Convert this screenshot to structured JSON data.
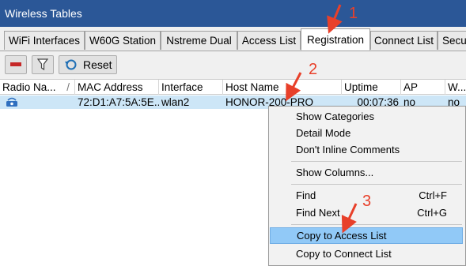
{
  "window": {
    "title": "Wireless Tables"
  },
  "tabs": [
    "WiFi Interfaces",
    "W60G Station",
    "Nstreme Dual",
    "Access List",
    "Registration",
    "Connect List",
    "Secu"
  ],
  "active_tab": "Registration",
  "toolbar": {
    "reset_label": "Reset"
  },
  "columns": [
    "Radio Na...",
    "MAC Address",
    "Interface",
    "Host Name",
    "Uptime",
    "AP",
    "W..."
  ],
  "rows": [
    {
      "radio": "",
      "mac": "72:D1:A7:5A:5E...",
      "interface": "wlan2",
      "host": "HONOR-200-PRO",
      "uptime": "00:07:36",
      "ap": "no",
      "w": "no"
    }
  ],
  "context_menu": {
    "items": [
      {
        "label": "Show Categories",
        "shortcut": ""
      },
      {
        "label": "Detail Mode",
        "shortcut": ""
      },
      {
        "label": "Don't Inline Comments",
        "shortcut": ""
      },
      {
        "label": "Show Columns...",
        "shortcut": ""
      },
      {
        "label": "Find",
        "shortcut": "Ctrl+F"
      },
      {
        "label": "Find Next",
        "shortcut": "Ctrl+G"
      },
      {
        "label": "Copy to Access List",
        "shortcut": ""
      },
      {
        "label": "Copy to Connect List",
        "shortcut": ""
      }
    ],
    "highlighted": "Copy to Access List"
  },
  "annotations": [
    "1",
    "2",
    "3"
  ],
  "colors": {
    "titlebar": "#2b5797",
    "selection": "#cde6f7",
    "menu_highlight": "#91c9f7",
    "annotation": "#e8402a"
  }
}
